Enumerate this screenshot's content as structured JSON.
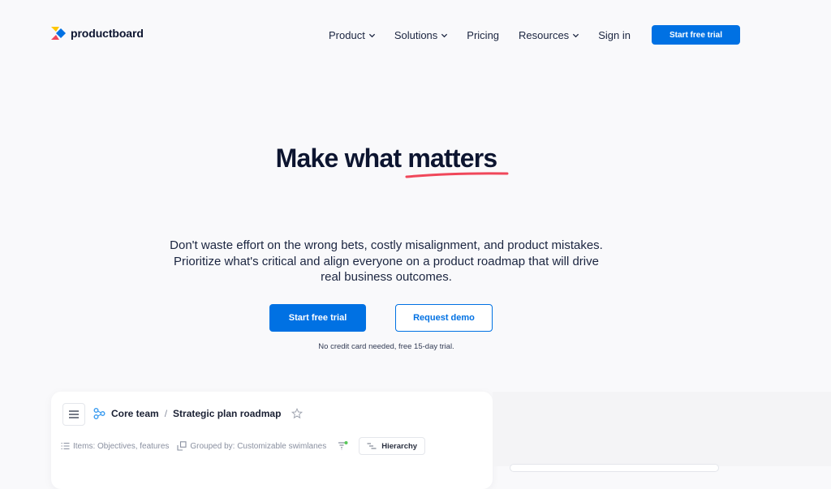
{
  "nav": {
    "brand": "productboard",
    "items": [
      {
        "label": "Product",
        "dropdown": true
      },
      {
        "label": "Solutions",
        "dropdown": true
      },
      {
        "label": "Pricing",
        "dropdown": false
      },
      {
        "label": "Resources",
        "dropdown": true
      },
      {
        "label": "Sign in",
        "dropdown": false
      }
    ],
    "cta_label": "Start free trial"
  },
  "hero": {
    "title": "Make what matters",
    "subtitle": "Don't waste effort on the wrong bets, costly misalignment, and product mistakes. Prioritize what's critical and align everyone on a product roadmap that will drive real business outcomes.",
    "primary_button": "Start free trial",
    "secondary_button": "Request demo",
    "note": "No credit card needed, free 15-day trial."
  },
  "preview": {
    "breadcrumb_team": "Core team",
    "breadcrumb_separator": "/",
    "breadcrumb_page": "Strategic plan roadmap",
    "items_label": "Items: Objectives, features",
    "grouped_label": "Grouped by: Customizable swimlanes",
    "hierarchy_label": "Hierarchy"
  },
  "colors": {
    "accent": "#0071e3",
    "underline": "#f0475a",
    "text": "#0d1530"
  }
}
